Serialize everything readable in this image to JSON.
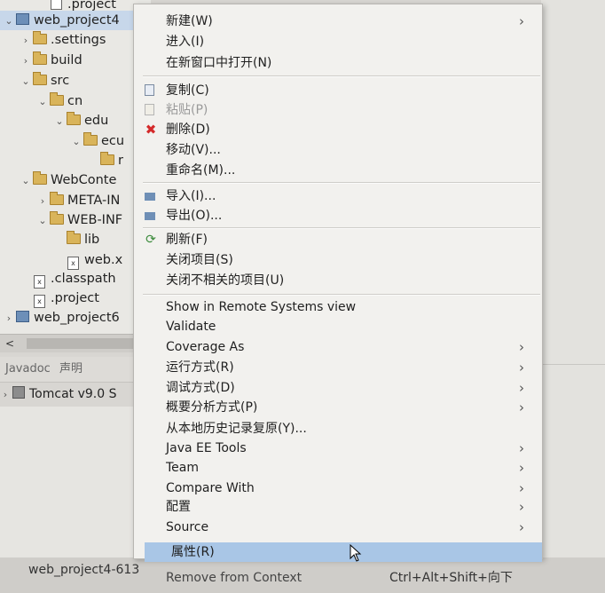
{
  "explorer": {
    "rows": [
      {
        "label": ".project",
        "indent": 2,
        "kind": "file"
      },
      {
        "label": "web_project4",
        "indent": 0,
        "kind": "project",
        "chevron": "v",
        "selected": true
      },
      {
        "label": ".settings",
        "indent": 1,
        "kind": "folder",
        "chevron": ">"
      },
      {
        "label": "build",
        "indent": 1,
        "kind": "folder",
        "chevron": ">"
      },
      {
        "label": "src",
        "indent": 1,
        "kind": "folder",
        "chevron": "v"
      },
      {
        "label": "cn",
        "indent": 2,
        "kind": "folder",
        "chevron": "v"
      },
      {
        "label": "edu",
        "indent": 3,
        "kind": "folder",
        "chevron": "v"
      },
      {
        "label": "ecu",
        "indent": 4,
        "kind": "folder",
        "chevron": "v"
      },
      {
        "label": "r",
        "indent": 5,
        "kind": "folder",
        "chevron": ""
      },
      {
        "label": "WebConte",
        "indent": 1,
        "kind": "folder",
        "chevron": "v"
      },
      {
        "label": "META-IN",
        "indent": 2,
        "kind": "folder",
        "chevron": ">"
      },
      {
        "label": "WEB-INF",
        "indent": 2,
        "kind": "folder",
        "chevron": "v"
      },
      {
        "label": "lib",
        "indent": 3,
        "kind": "folder",
        "chevron": ""
      },
      {
        "label": "web.x",
        "indent": 3,
        "kind": "xfile",
        "chevron": ""
      },
      {
        "label": ".classpath",
        "indent": 1,
        "kind": "xfile",
        "chevron": ""
      },
      {
        "label": ".project",
        "indent": 1,
        "kind": "xfile",
        "chevron": ""
      },
      {
        "label": "web_project6",
        "indent": 0,
        "kind": "project",
        "chevron": ">"
      }
    ],
    "scroll_left": "<"
  },
  "bottom": {
    "tab1": "Javadoc",
    "tab2": "声明",
    "server": "Tomcat v9.0 S"
  },
  "status": {
    "text": "web_project4-613",
    "shortcut": "Ctrl+Alt+Shift+向下"
  },
  "menu": {
    "items": [
      {
        "label": "新建(W)",
        "sub": true
      },
      {
        "label": "进入(I)"
      },
      {
        "label": "在新窗口中打开(N)"
      },
      {
        "sep": true
      },
      {
        "label": "复制(C)",
        "icon": "copy-icon"
      },
      {
        "label": "粘贴(P)",
        "icon": "paste-icon",
        "disabled": true
      },
      {
        "label": "删除(D)",
        "icon": "delete-icon"
      },
      {
        "label": "移动(V)..."
      },
      {
        "label": "重命名(M)..."
      },
      {
        "sep": true
      },
      {
        "label": "导入(I)...",
        "icon": "import-icon"
      },
      {
        "label": "导出(O)...",
        "icon": "export-icon"
      },
      {
        "sep": true
      },
      {
        "label": "刷新(F)",
        "icon": "refresh-icon"
      },
      {
        "label": "关闭项目(S)"
      },
      {
        "label": "关闭不相关的项目(U)"
      },
      {
        "sep": true
      },
      {
        "label": "Show in Remote Systems view"
      },
      {
        "label": "Validate"
      },
      {
        "label": "Coverage As",
        "sub": true
      },
      {
        "label": "运行方式(R)",
        "sub": true
      },
      {
        "label": "调试方式(D)",
        "sub": true
      },
      {
        "label": "概要分析方式(P)",
        "sub": true
      },
      {
        "label": "从本地历史记录复原(Y)..."
      },
      {
        "label": "Java EE Tools",
        "sub": true
      },
      {
        "label": "Team",
        "sub": true
      },
      {
        "label": "Compare With",
        "sub": true
      },
      {
        "label": "配置",
        "sub": true
      },
      {
        "label": "Source",
        "sub": true
      },
      {
        "label": "属性(R)",
        "highlighted": true
      },
      {
        "label": "Remove from Context"
      }
    ]
  },
  "colors": {
    "menu_bg": "#f2f1ee",
    "highlight": "#a9c6e6",
    "delete_icon": "#d42a2a"
  }
}
